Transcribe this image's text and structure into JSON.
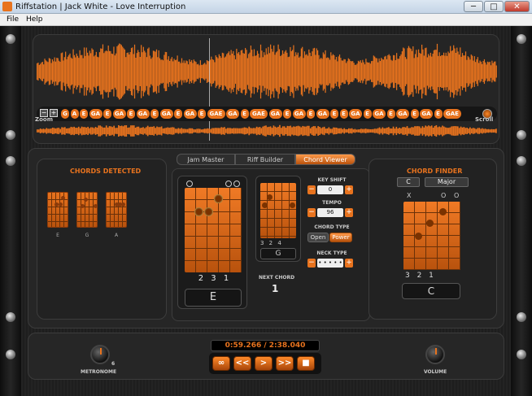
{
  "window": {
    "title": "Riffstation | Jack White - Love Interruption",
    "min_label": "─",
    "max_label": "□",
    "close_label": "✕"
  },
  "menu": {
    "file": "File",
    "help": "Help"
  },
  "waveform": {
    "zoom_label": "Zoom",
    "scroll_label": "Scroll",
    "zoom_minus": "−",
    "zoom_plus": "+",
    "chord_tokens": [
      "G",
      "A",
      "E",
      "GA",
      "E",
      "GA",
      "E",
      "GA",
      "E",
      "GA",
      "E",
      "GA",
      "E",
      "GAE",
      "GA",
      "E",
      "GAE",
      "GA",
      "E",
      "GA",
      "E",
      "GA",
      "E",
      "E",
      "GA",
      "E",
      "GA",
      "E",
      "GA",
      "E",
      "GA",
      "E",
      "GAE",
      "GA",
      "E",
      "GAE",
      "GA",
      "E",
      "GA",
      "E"
    ],
    "accent_color": "#e8731e"
  },
  "tabs": {
    "jam_master": "Jam Master",
    "riff_builder": "Riff Builder",
    "chord_viewer": "Chord Viewer",
    "active": "chord_viewer"
  },
  "chords_detected": {
    "title": "CHORDS DETECTED",
    "chords": [
      {
        "name": "E"
      },
      {
        "name": "G"
      },
      {
        "name": "A"
      }
    ]
  },
  "chord_viewer": {
    "current_chord": "E",
    "current_fingering": "2 3 1",
    "next_chord": "G",
    "next_fingering": "3 2      4",
    "next_chord_label": "NEXT CHORD",
    "next_chord_number": "1"
  },
  "controls": {
    "key_shift_label": "KEY SHIFT",
    "key_shift_value": "0",
    "tempo_label": "TEMPO",
    "tempo_value": "96",
    "chord_type_label": "CHORD TYPE",
    "chord_type_open": "Open",
    "chord_type_power": "Power",
    "chord_type_selected": "Power",
    "neck_type_label": "NECK TYPE",
    "neck_type_value": "• • • • •",
    "minus": "−",
    "plus": "+"
  },
  "chord_finder": {
    "title": "CHORD FINDER",
    "root": "C",
    "quality": "Major",
    "markers": [
      "X",
      "",
      "",
      "O",
      "",
      "O"
    ],
    "fingering": "3 2    1",
    "name": "C"
  },
  "transport": {
    "time": "0:59.266 / 2:38.040",
    "loop": "∞",
    "rewind": "<<",
    "play": ">",
    "forward": ">>",
    "stop": "■",
    "metronome_label": "METRONOME",
    "metronome_value": "6",
    "volume_label": "VOLUME"
  }
}
